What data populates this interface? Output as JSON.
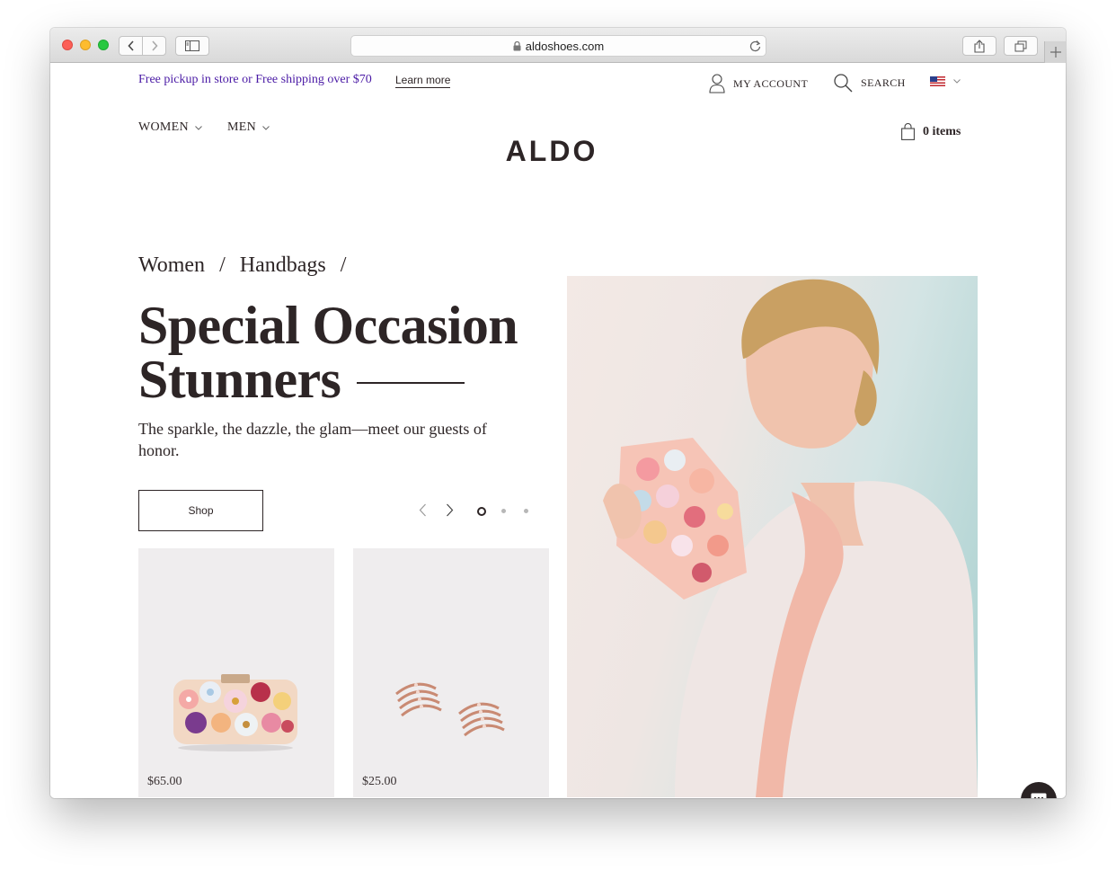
{
  "browser": {
    "url": "aldoshoes.com"
  },
  "header": {
    "promo": "Free pickup in store or Free shipping over $70",
    "learn_more": "Learn more",
    "account": "MY ACCOUNT",
    "search": "SEARCH",
    "locale_icon": "us-flag-icon"
  },
  "nav": {
    "women": "WOMEN",
    "men": "MEN",
    "logo": "ALDO",
    "cart": "0 items"
  },
  "hero": {
    "breadcrumb": [
      "Women",
      "/",
      "Handbags",
      "/"
    ],
    "title_line1": "Special Occasion",
    "title_line2": "Stunners",
    "subtitle": "The sparkle, the dazzle, the glam—meet our guests of honor.",
    "cta": "Shop",
    "slide_count": 3,
    "active_slide": 1
  },
  "products": [
    {
      "name": "floral-clutch",
      "price": "$65.00"
    },
    {
      "name": "rose-gold-earrings",
      "price": "$25.00"
    }
  ],
  "colors": {
    "text": "#2d2526",
    "promo": "#4a1aa5",
    "card_bg": "#efedee"
  }
}
